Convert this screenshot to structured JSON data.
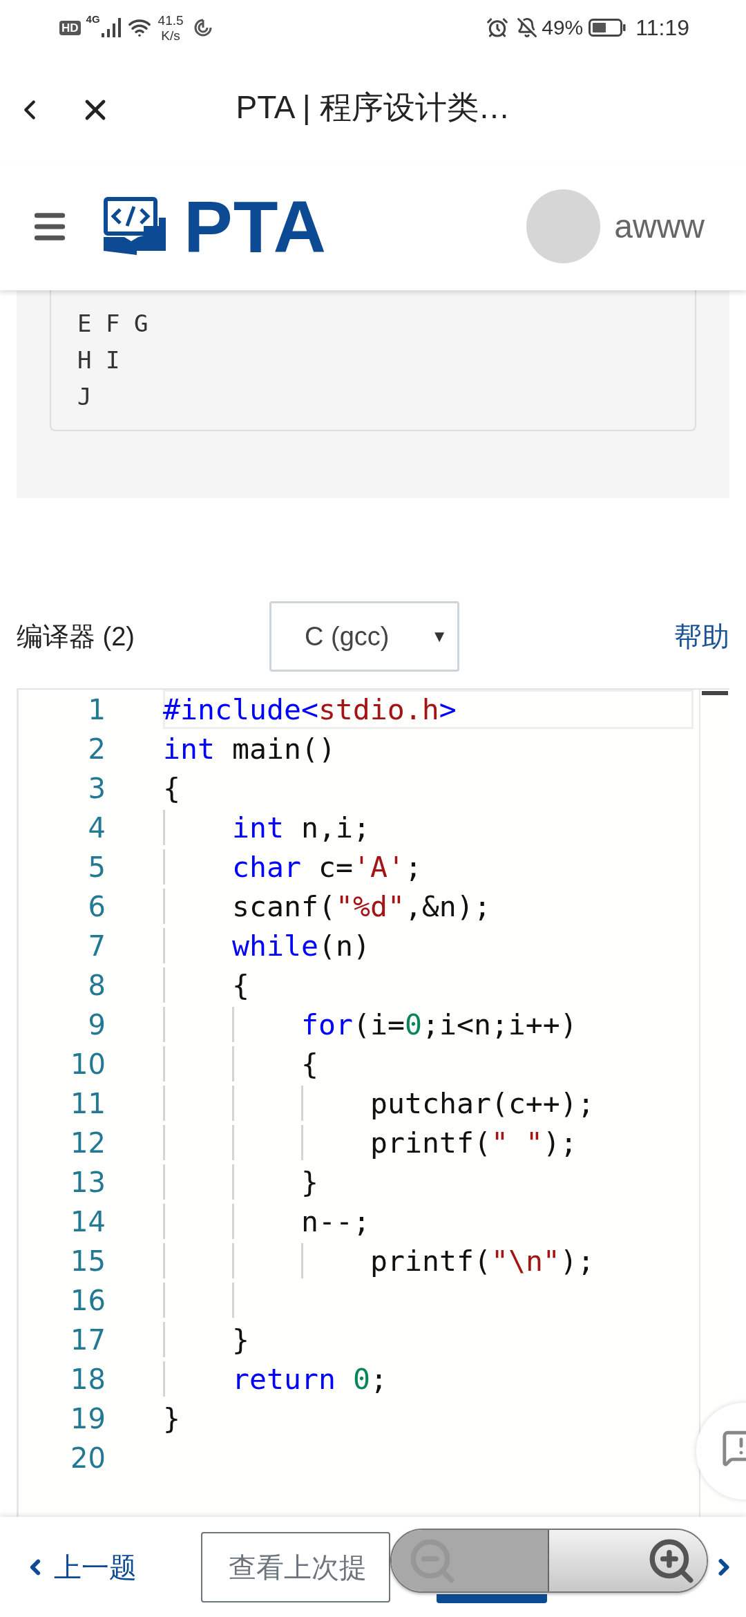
{
  "status_bar": {
    "hd": "HD",
    "network": "4G",
    "speed_value": "41.5",
    "speed_unit": "K/s",
    "battery": "49%",
    "time": "11:19"
  },
  "browser_bar": {
    "title": "PTA | 程序设计类…"
  },
  "header": {
    "logo_text": "PTA",
    "username": "awww"
  },
  "sample_output": {
    "lines": [
      "E F G",
      "H I",
      "J"
    ]
  },
  "compiler": {
    "label": "编译器 (2)",
    "selected_language": "C (gcc)",
    "dropdown_arrow": "▼",
    "help_link": "帮助"
  },
  "editor": {
    "lines": [
      {
        "number": "1",
        "active": true,
        "tokens": [
          {
            "kind": "keyword",
            "text": "#include<"
          },
          {
            "kind": "string",
            "text": "stdio.h"
          },
          {
            "kind": "keyword",
            "text": ">"
          }
        ]
      },
      {
        "number": "2",
        "active": false,
        "tokens": [
          {
            "kind": "keyword",
            "text": "int"
          },
          {
            "kind": "plain",
            "text": " main()"
          }
        ]
      },
      {
        "number": "3",
        "active": false,
        "tokens": [
          {
            "kind": "plain",
            "text": "{"
          }
        ],
        "children": [
          {
            "number": "4",
            "active": false,
            "tokens": [
              {
                "kind": "keyword",
                "text": "int"
              },
              {
                "kind": "plain",
                "text": " n,i;"
              }
            ]
          },
          {
            "number": "5",
            "active": false,
            "tokens": [
              {
                "kind": "keyword",
                "text": "char"
              },
              {
                "kind": "plain",
                "text": " c="
              },
              {
                "kind": "string",
                "text": "'A'"
              },
              {
                "kind": "plain",
                "text": ";"
              }
            ]
          },
          {
            "number": "6",
            "active": false,
            "tokens": [
              {
                "kind": "plain",
                "text": "scanf("
              },
              {
                "kind": "string",
                "text": "\"%d\""
              },
              {
                "kind": "plain",
                "text": ",&n);"
              }
            ]
          },
          {
            "number": "7",
            "active": false,
            "tokens": [
              {
                "kind": "keyword",
                "text": "while"
              },
              {
                "kind": "plain",
                "text": "(n)"
              }
            ]
          },
          {
            "number": "8",
            "active": false,
            "tokens": [
              {
                "kind": "plain",
                "text": "{"
              }
            ],
            "children": [
              {
                "number": "9",
                "active": false,
                "tokens": [
                  {
                    "kind": "keyword",
                    "text": "for"
                  },
                  {
                    "kind": "plain",
                    "text": "(i="
                  },
                  {
                    "kind": "number",
                    "text": "0"
                  },
                  {
                    "kind": "plain",
                    "text": ";i<n;i++)"
                  }
                ]
              },
              {
                "number": "10",
                "active": false,
                "tokens": [
                  {
                    "kind": "plain",
                    "text": "{"
                  }
                ],
                "children": [
                  {
                    "number": "11",
                    "active": false,
                    "tokens": [
                      {
                        "kind": "plain",
                        "text": "putchar(c++);"
                      }
                    ]
                  },
                  {
                    "number": "12",
                    "active": false,
                    "tokens": [
                      {
                        "kind": "plain",
                        "text": "printf("
                      },
                      {
                        "kind": "string",
                        "text": "\" \""
                      },
                      {
                        "kind": "plain",
                        "text": ");"
                      }
                    ]
                  }
                ]
              },
              {
                "number": "13",
                "active": false,
                "tokens": [
                  {
                    "kind": "plain",
                    "text": "}"
                  }
                ]
              },
              {
                "number": "14",
                "active": false,
                "tokens": [
                  {
                    "kind": "plain",
                    "text": "n--;"
                  }
                ],
                "children": [
                  {
                    "number": "15",
                    "active": false,
                    "tokens": [
                      {
                        "kind": "plain",
                        "text": "printf("
                      },
                      {
                        "kind": "string",
                        "text": "\"\\n\""
                      },
                      {
                        "kind": "plain",
                        "text": ");"
                      }
                    ]
                  }
                ]
              },
              {
                "number": "16",
                "active": false
              }
            ]
          },
          {
            "number": "17",
            "active": false,
            "tokens": [
              {
                "kind": "plain",
                "text": "}"
              }
            ]
          },
          {
            "number": "18",
            "active": false,
            "tokens": [
              {
                "kind": "keyword",
                "text": "return "
              },
              {
                "kind": "number",
                "text": "0"
              },
              {
                "kind": "plain",
                "text": ";"
              }
            ]
          }
        ]
      },
      {
        "number": "19",
        "active": false,
        "tokens": [
          {
            "kind": "plain",
            "text": "}"
          }
        ]
      },
      {
        "number": "20",
        "active": false
      }
    ]
  },
  "bottom_bar": {
    "prev_link": "上一题",
    "view_last_button": "查看上次提"
  }
}
